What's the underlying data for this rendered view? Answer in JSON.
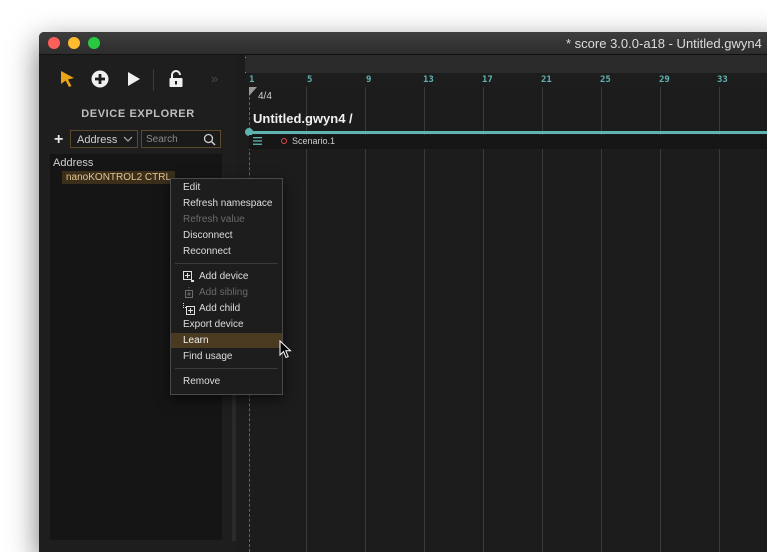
{
  "window": {
    "title": "* score 3.0.0-a18 - Untitled.gwyn4"
  },
  "toolbar": {
    "tools": [
      {
        "name": "select-tool",
        "icon": "arrow-cursor-icon"
      },
      {
        "name": "create-tool",
        "icon": "plus-circle-icon"
      },
      {
        "name": "play-tool",
        "icon": "play-icon"
      },
      {
        "name": "lock-tool",
        "icon": "unlock-icon"
      }
    ],
    "more_label": "»",
    "accent": "#e8a317"
  },
  "explorer": {
    "title": "DEVICE EXPLORER",
    "add_label": "+",
    "column_select": "Address",
    "search_placeholder": "Search",
    "tree_header": "Address",
    "devices": [
      "nanoKONTROL2 CTRL"
    ]
  },
  "context_menu": {
    "items": [
      {
        "label": "Edit",
        "enabled": true
      },
      {
        "label": "Refresh namespace",
        "enabled": true
      },
      {
        "label": "Refresh value",
        "enabled": false
      },
      {
        "label": "Disconnect",
        "enabled": true
      },
      {
        "label": "Reconnect",
        "enabled": true
      },
      {
        "label": "Add device",
        "enabled": true,
        "icon": "add-device-icon"
      },
      {
        "label": "Add sibling",
        "enabled": false,
        "icon": "add-sibling-icon"
      },
      {
        "label": "Add child",
        "enabled": true,
        "icon": "add-child-icon"
      },
      {
        "label": "Export device",
        "enabled": true
      },
      {
        "label": "Learn",
        "enabled": true,
        "highlighted": true
      },
      {
        "label": "Find usage",
        "enabled": true
      },
      {
        "label": "Remove",
        "enabled": true
      }
    ]
  },
  "timeline": {
    "ruler_ticks": [
      "1",
      "5",
      "9",
      "13",
      "17",
      "21",
      "25",
      "29",
      "33"
    ],
    "time_signature": "4/4",
    "interval_title": "Untitled.gwyn4 /",
    "scenario_label": "Scenario.1",
    "interval_color": "#5fb3b0",
    "scenario_state_color": "#e04a4a"
  }
}
